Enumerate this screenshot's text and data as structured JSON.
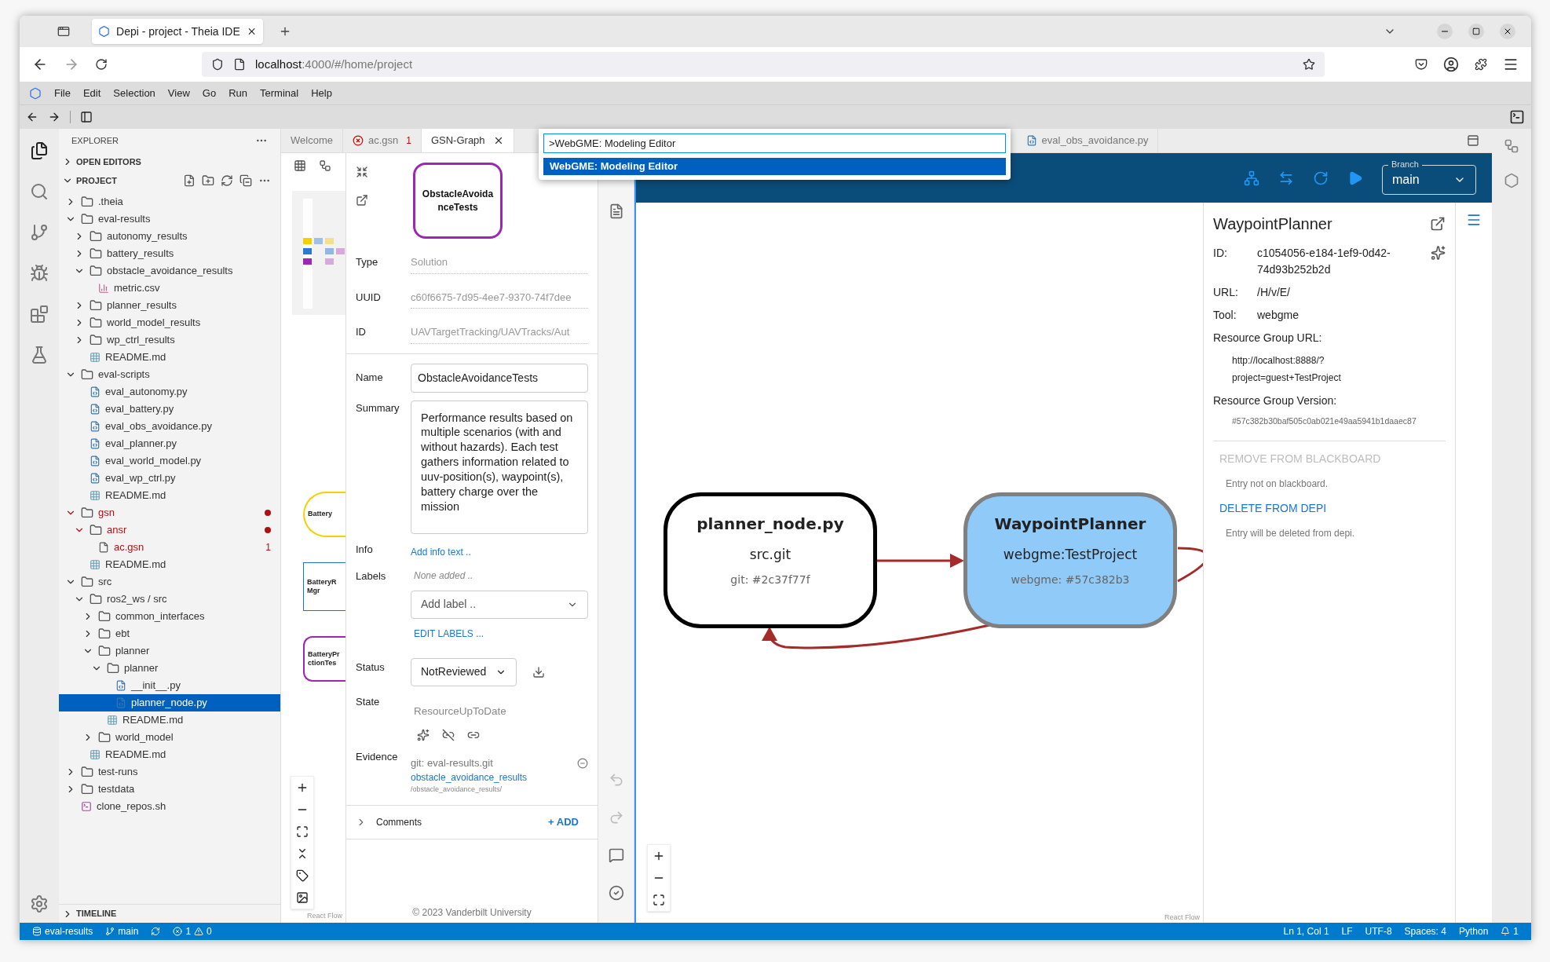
{
  "browser": {
    "tab_title": "Depi - project - Theia IDE",
    "url_host": "localhost",
    "url_path": ":4000/#/home/project"
  },
  "menu": [
    "File",
    "Edit",
    "Selection",
    "View",
    "Go",
    "Run",
    "Terminal",
    "Help"
  ],
  "explorer": {
    "title": "EXPLORER",
    "open_editors": {
      "label": "OPEN EDITORS",
      "expanded": false
    },
    "project": {
      "label": "PROJECT",
      "expanded": true
    },
    "tree": [
      {
        "label": ".theia",
        "kind": "folder",
        "expanded": false,
        "selected": false
      },
      {
        "label": "eval-results",
        "kind": "folder",
        "expanded": true,
        "selected": false,
        "children": [
          {
            "label": "autonomy_results",
            "kind": "folder",
            "expanded": false,
            "selected": false
          },
          {
            "label": "battery_results",
            "kind": "folder",
            "expanded": false,
            "selected": false
          },
          {
            "label": "obstacle_avoidance_results",
            "kind": "folder",
            "expanded": true,
            "selected": false,
            "children": [
              {
                "label": "metric.csv",
                "kind": "csv",
                "selected": false
              }
            ]
          },
          {
            "label": "planner_results",
            "kind": "folder",
            "expanded": false,
            "selected": false
          },
          {
            "label": "world_model_results",
            "kind": "folder",
            "expanded": false,
            "selected": false
          },
          {
            "label": "wp_ctrl_results",
            "kind": "folder",
            "expanded": false,
            "selected": false
          },
          {
            "label": "README.md",
            "kind": "markdown",
            "selected": false
          }
        ]
      },
      {
        "label": "eval-scripts",
        "kind": "folder",
        "expanded": true,
        "selected": false,
        "children": [
          {
            "label": "eval_autonomy.py",
            "kind": "python",
            "selected": false
          },
          {
            "label": "eval_battery.py",
            "kind": "python",
            "selected": false
          },
          {
            "label": "eval_obs_avoidance.py",
            "kind": "python",
            "selected": false
          },
          {
            "label": "eval_planner.py",
            "kind": "python",
            "selected": false
          },
          {
            "label": "eval_world_model.py",
            "kind": "python",
            "selected": false
          },
          {
            "label": "eval_wp_ctrl.py",
            "kind": "python",
            "selected": false
          },
          {
            "label": "README.md",
            "kind": "markdown",
            "selected": false
          }
        ]
      },
      {
        "label": "gsn",
        "kind": "folder",
        "expanded": true,
        "selected": false,
        "modified": true,
        "children": [
          {
            "label": "ansr",
            "kind": "folder",
            "expanded": true,
            "selected": false,
            "modified": true,
            "children": [
              {
                "label": "ac.gsn",
                "kind": "file",
                "selected": false,
                "modified": true,
                "badge": "1"
              }
            ]
          },
          {
            "label": "README.md",
            "kind": "markdown",
            "selected": false
          }
        ]
      },
      {
        "label": "src",
        "kind": "folder",
        "expanded": true,
        "selected": false,
        "children": [
          {
            "label": "ros2_ws / src",
            "kind": "folder",
            "expanded": true,
            "selected": false,
            "children": [
              {
                "label": "common_interfaces",
                "kind": "folder",
                "expanded": false,
                "selected": false
              },
              {
                "label": "ebt",
                "kind": "folder",
                "expanded": false,
                "selected": false
              },
              {
                "label": "planner",
                "kind": "folder",
                "expanded": true,
                "selected": false,
                "children": [
                  {
                    "label": "planner",
                    "kind": "folder",
                    "expanded": true,
                    "selected": false,
                    "children": [
                      {
                        "label": "__init__.py",
                        "kind": "python",
                        "selected": false
                      },
                      {
                        "label": "planner_node.py",
                        "kind": "python",
                        "selected": true
                      }
                    ]
                  },
                  {
                    "label": "README.md",
                    "kind": "markdown",
                    "selected": false
                  }
                ]
              },
              {
                "label": "world_model",
                "kind": "folder",
                "expanded": false,
                "selected": false
              }
            ]
          },
          {
            "label": "README.md",
            "kind": "markdown",
            "selected": false
          }
        ]
      },
      {
        "label": "test-runs",
        "kind": "folder",
        "expanded": false,
        "selected": false
      },
      {
        "label": "testdata",
        "kind": "folder",
        "expanded": false,
        "selected": false
      },
      {
        "label": "clone_repos.sh",
        "kind": "shell",
        "selected": false
      }
    ],
    "timeline": {
      "label": "TIMELINE",
      "expanded": false
    }
  },
  "editor_tabs": [
    {
      "label": "Welcome",
      "kind": "plain",
      "selected": false
    },
    {
      "label": "ac.gsn",
      "kind": "error",
      "badge": "1",
      "selected": false
    },
    {
      "label": "GSN-Graph",
      "kind": "plain",
      "selected": true
    },
    {
      "label": "eval_obs_avoidance.py",
      "kind": "python",
      "selected": false
    }
  ],
  "command_palette": {
    "value": ">WebGME: Modeling Editor",
    "items": [
      {
        "label": "WebGME: Modeling Editor",
        "selected": true
      }
    ]
  },
  "gsn": {
    "canvas_nodes": [
      {
        "kind": "goal",
        "lines": [
          "Battery"
        ]
      },
      {
        "kind": "strategy",
        "lines": [
          "BatteryR",
          "Mgr"
        ]
      },
      {
        "kind": "solution",
        "lines": [
          "BatteryPr",
          "ctionTes"
        ]
      }
    ],
    "attribution": "React Flow",
    "node_preview": "ObstacleAvoidanceTests",
    "readonly": [
      {
        "label": "Type",
        "value": "Solution"
      },
      {
        "label": "UUID",
        "value": "c60f6675-7d95-4ee7-9370-74f7dee"
      },
      {
        "label": "ID",
        "value": "UAVTargetTracking/UAVTracks/Aut"
      }
    ],
    "name": {
      "label": "Name",
      "value": "ObstacleAvoidanceTests"
    },
    "summary": {
      "label": "Summary",
      "value": "Performance results based on multiple scenarios (with and without hazards). Each test gathers information related to uuv-position(s), waypoint(s), battery charge over the mission"
    },
    "info": {
      "label": "Info",
      "link": "Add info text .."
    },
    "labels": {
      "label": "Labels",
      "empty": "None added ..",
      "placeholder": "Add label ..",
      "edit": "EDIT LABELS ..."
    },
    "status": {
      "label": "Status",
      "value": "NotReviewed"
    },
    "state": {
      "label": "State",
      "value": "ResourceUpToDate"
    },
    "evidence": {
      "label": "Evidence",
      "repo": "git: eval-results.git",
      "link": "obstacle_avoidance_results",
      "path": "/obstacle_avoidance_results/"
    },
    "comments": {
      "label": "Comments",
      "expanded": false,
      "add": "+ ADD"
    },
    "footer": "© 2023 Vanderbilt University"
  },
  "dependency_graph": {
    "branch": {
      "label": "Branch",
      "value": "main"
    },
    "nodes": [
      {
        "title": "planner_node.py",
        "subtitle": "src.git",
        "version": "git: #2c37f77f",
        "selected": false
      },
      {
        "title": "WaypointPlanner",
        "subtitle": "webgme:TestProject",
        "version": "webgme: #57c382b3",
        "selected": true
      }
    ],
    "attribution": "React Flow",
    "details": {
      "title": "WaypointPlanner",
      "fields": [
        {
          "label": "ID:",
          "value": "c1054056-e184-1ef9-0d42-74d93b252b2d"
        },
        {
          "label": "URL:",
          "value": "/H/v/E/"
        },
        {
          "label": "Tool:",
          "value": "webgme"
        }
      ],
      "rg_url_label": "Resource Group URL:",
      "rg_url": "http://localhost:8888/? project=guest+TestProject",
      "rg_version_label": "Resource Group Version:",
      "rg_version": "#57c382b30baf505c0ab021e49aa5941b1daaec87",
      "actions": [
        {
          "label": "REMOVE FROM BLACKBOARD",
          "disabled": true,
          "note": "Entry not on blackboard."
        },
        {
          "label": "DELETE FROM DEPI",
          "disabled": false,
          "note": "Entry will be deleted from depi."
        }
      ]
    }
  },
  "status_bar": {
    "repo": "eval-results",
    "branch": "main",
    "errors": "1",
    "warnings": "0",
    "right": [
      "Ln 1, Col 1",
      "LF",
      "UTF-8",
      "Spaces: 4",
      "Python"
    ],
    "notifications": "1"
  }
}
